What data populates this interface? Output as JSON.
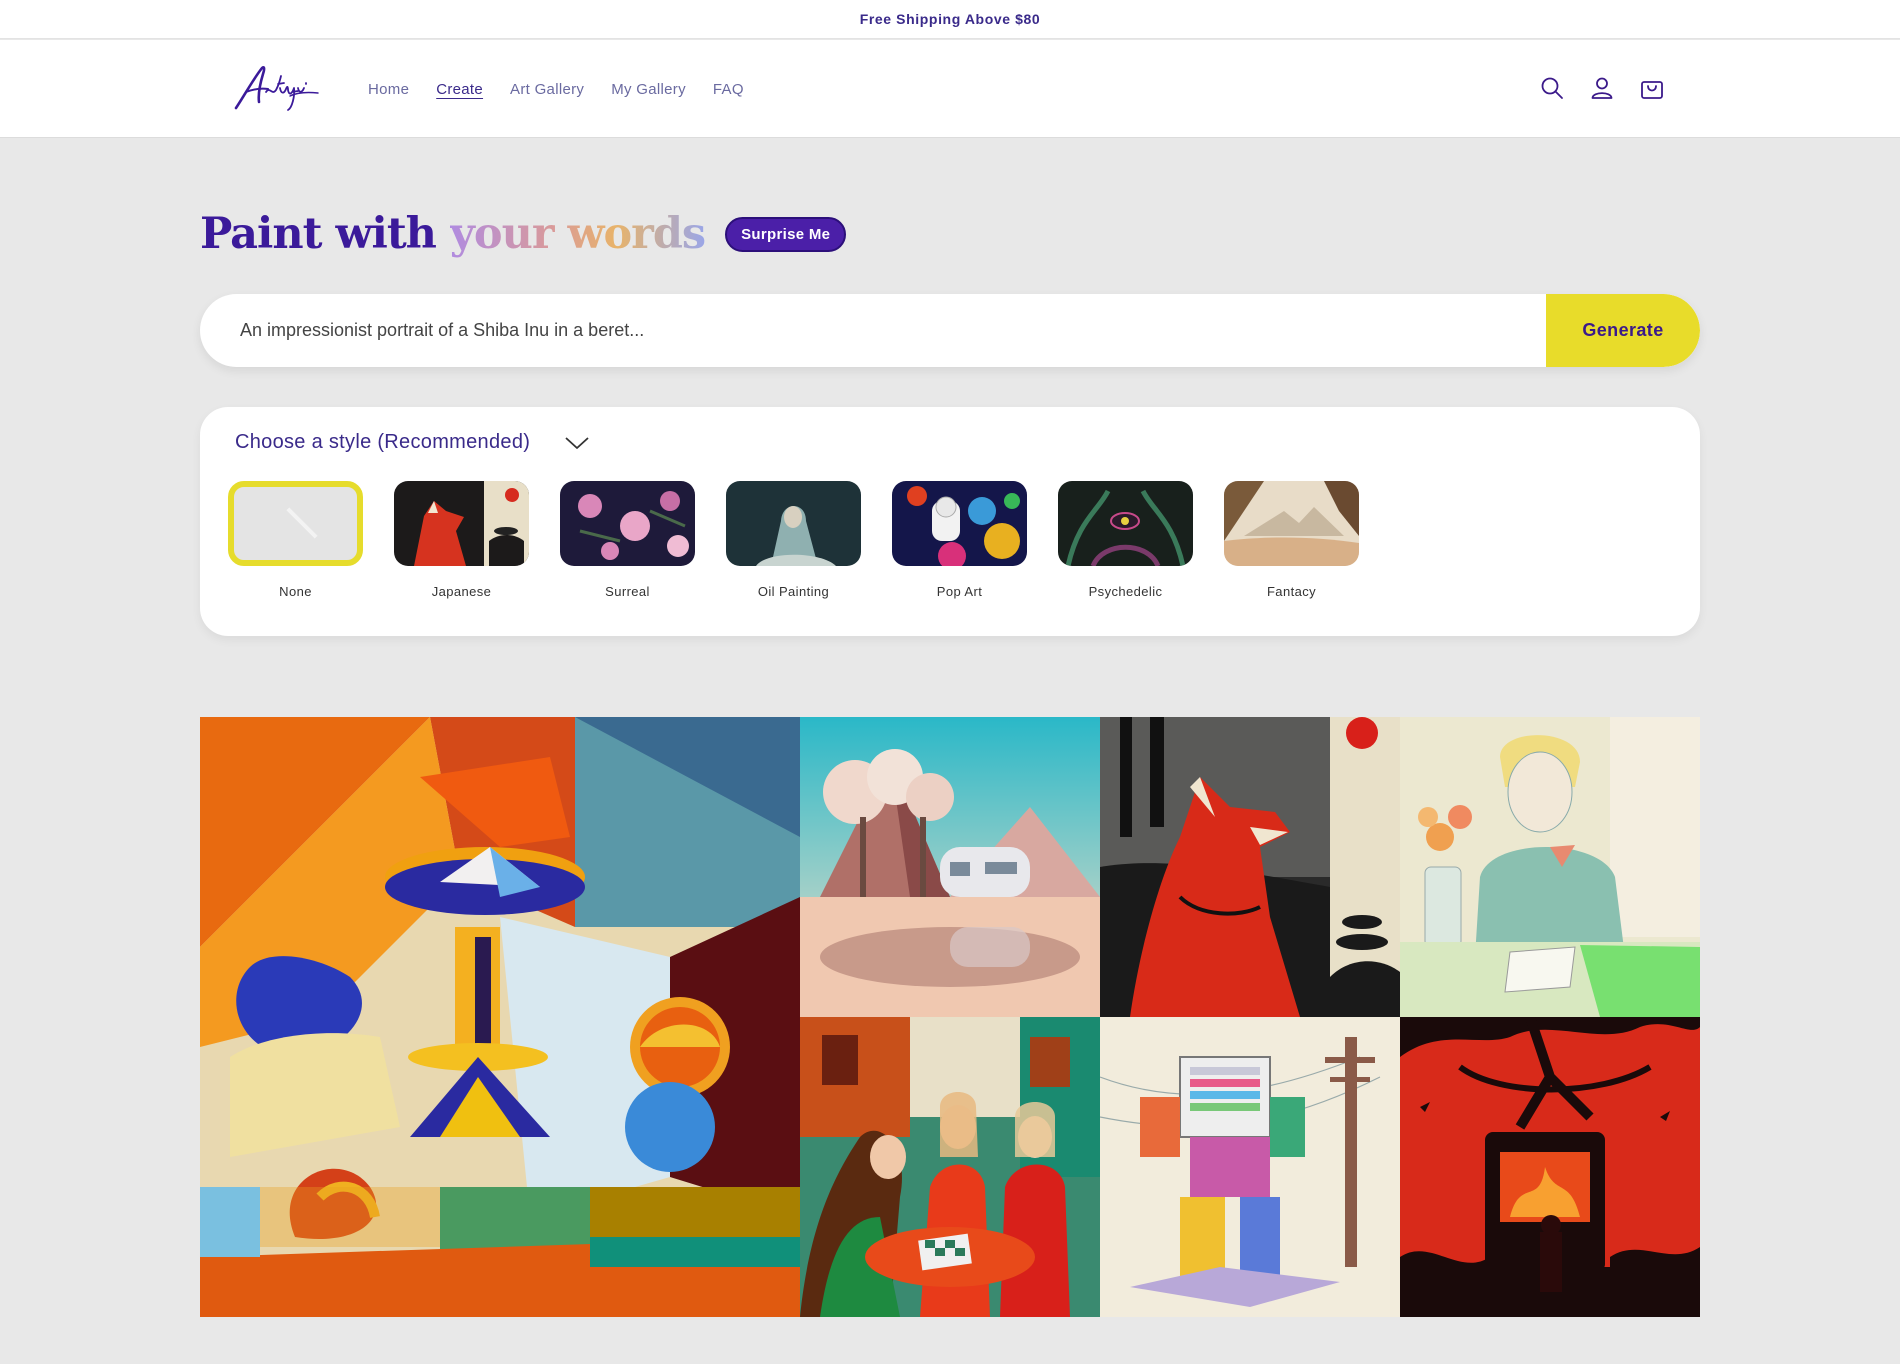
{
  "announcement": "Free Shipping Above $80",
  "brand": {
    "logo_text": "Artifici"
  },
  "nav": [
    {
      "label": "Home",
      "active": false
    },
    {
      "label": "Create",
      "active": true
    },
    {
      "label": "Art Gallery",
      "active": false
    },
    {
      "label": "My Gallery",
      "active": false
    },
    {
      "label": "FAQ",
      "active": false
    }
  ],
  "header_icons": [
    "search-icon",
    "account-icon",
    "cart-icon"
  ],
  "hero": {
    "title_part1": "Paint with ",
    "title_part2": "your words",
    "surprise_label": "Surprise Me"
  },
  "prompt": {
    "placeholder": "An impressionist portrait of a Shiba Inu in a beret...",
    "generate_label": "Generate"
  },
  "styles": {
    "heading": "Choose a style (Recommended)",
    "selected": "None",
    "items": [
      {
        "label": "None"
      },
      {
        "label": "Japanese"
      },
      {
        "label": "Surreal"
      },
      {
        "label": "Oil Painting"
      },
      {
        "label": "Pop Art"
      },
      {
        "label": "Psychedelic"
      },
      {
        "label": "Fantacy"
      }
    ]
  },
  "gallery": {
    "items": [
      "cubist-still-life",
      "surreal-desert-caravan",
      "japanese-red-fox",
      "pencil-portrait-flowers",
      "women-playing-chess",
      "robot-sketch",
      "red-horror-scene"
    ]
  },
  "colors": {
    "brand_purple": "#3b1a9a",
    "generate_yellow": "#e8dc2a",
    "page_bg": "#e8e8e8"
  }
}
